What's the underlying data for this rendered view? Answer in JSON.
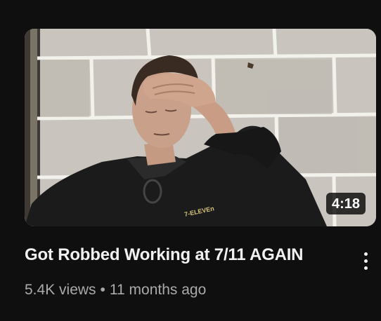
{
  "video": {
    "title": "Got Robbed Working at 7/11 AGAIN",
    "duration": "4:18",
    "views": "5.4K views",
    "separator": "•",
    "age": "11 months ago",
    "thumbnail_shirt_logo": "7-ELEVEn"
  },
  "icons": {
    "menu": "more-vertical-icon"
  },
  "colors": {
    "background": "#0f0f0f",
    "title_text": "#f1f1f1",
    "secondary_text": "#aaaaaa",
    "duration_badge_bg": "#000000"
  }
}
